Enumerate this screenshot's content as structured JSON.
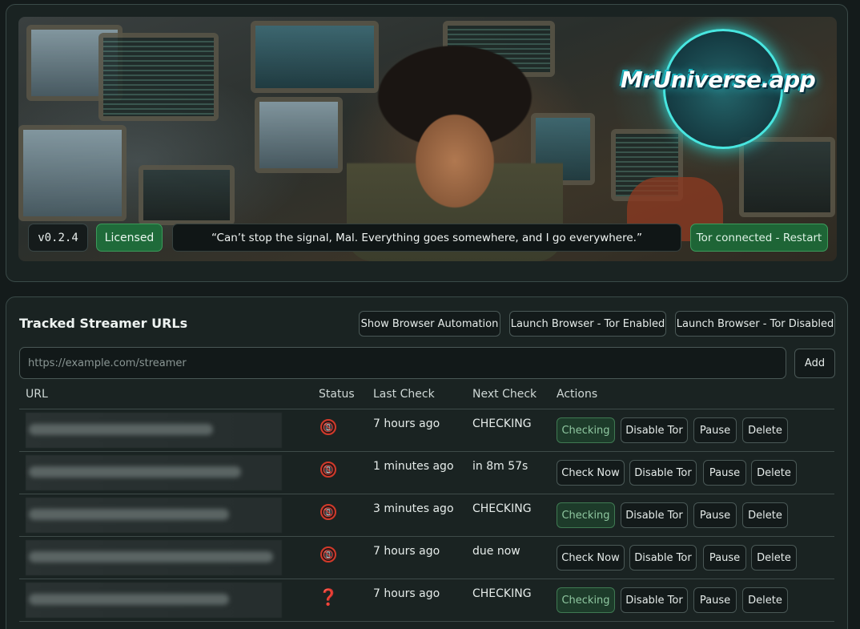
{
  "header": {
    "logo_text": "MrUniverse.app",
    "version": "v0.2.4",
    "license_badge": "Licensed",
    "quote": "“Can’t stop the signal, Mal. Everything goes somewhere, and I go everywhere.”",
    "tor_status": "Tor connected - Restart"
  },
  "tracked": {
    "title": "Tracked Streamer URLs",
    "buttons": {
      "automation": "Show Browser Automation",
      "tor_enabled": "Launch Browser - Tor Enabled",
      "tor_disabled": "Launch Browser - Tor Disabled"
    },
    "input": {
      "placeholder": "https://example.com/streamer",
      "value": ""
    },
    "add_label": "Add",
    "columns": [
      "URL",
      "Status",
      "Last Check",
      "Next Check",
      "Actions"
    ],
    "rows": [
      {
        "status_icon": "offline-phone-icon",
        "status_glyph": "📵",
        "last_check": "7 hours ago",
        "next_check": "CHECKING",
        "primary_action": "Checking",
        "primary_state": "checking",
        "tor_action": "Disable Tor",
        "pause": "Pause",
        "delete": "Delete"
      },
      {
        "status_icon": "offline-phone-icon",
        "status_glyph": "📵",
        "last_check": "1 minutes ago",
        "next_check": "in 8m 57s",
        "primary_action": "Check Now",
        "primary_state": "idle",
        "tor_action": "Disable Tor",
        "pause": "Pause",
        "delete": "Delete"
      },
      {
        "status_icon": "offline-phone-icon",
        "status_glyph": "📵",
        "last_check": "3 minutes ago",
        "next_check": "CHECKING",
        "primary_action": "Checking",
        "primary_state": "checking",
        "tor_action": "Disable Tor",
        "pause": "Pause",
        "delete": "Delete"
      },
      {
        "status_icon": "offline-phone-icon",
        "status_glyph": "📵",
        "last_check": "7 hours ago",
        "next_check": "due now",
        "primary_action": "Check Now",
        "primary_state": "idle",
        "tor_action": "Disable Tor",
        "pause": "Pause",
        "delete": "Delete"
      },
      {
        "status_icon": "question-mark-icon",
        "status_glyph": "❓",
        "last_check": "7 hours ago",
        "next_check": "CHECKING",
        "primary_action": "Checking",
        "primary_state": "checking",
        "tor_action": "Disable Tor",
        "pause": "Pause",
        "delete": "Delete"
      }
    ]
  },
  "colors": {
    "background": "#141b1b",
    "accent_green": "#1f6b3a",
    "checking_green": "#1d3b2a",
    "logo_cyan": "#48e6e0",
    "status_red": "#d23a2a"
  }
}
